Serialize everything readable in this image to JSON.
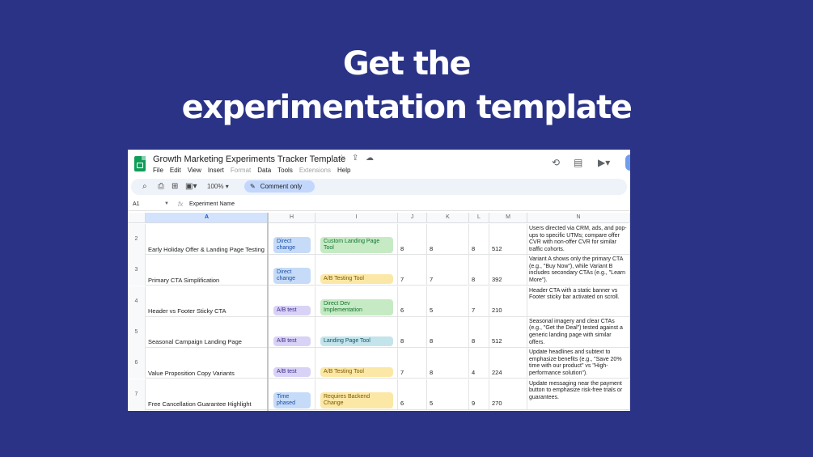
{
  "hero": {
    "line1": "Get the",
    "line2": "experimentation template"
  },
  "window": {
    "title": "Growth Marketing Experiments Tracker Template",
    "icons": [
      "star-icon",
      "move-to-drive-icon",
      "cloud-status-icon",
      "history-icon",
      "comments-icon",
      "meet-icon"
    ],
    "menu": [
      {
        "label": "File",
        "enabled": true
      },
      {
        "label": "Edit",
        "enabled": true
      },
      {
        "label": "View",
        "enabled": true
      },
      {
        "label": "Insert",
        "enabled": true
      },
      {
        "label": "Format",
        "enabled": false
      },
      {
        "label": "Data",
        "enabled": true
      },
      {
        "label": "Tools",
        "enabled": true
      },
      {
        "label": "Extensions",
        "enabled": false
      },
      {
        "label": "Help",
        "enabled": true
      }
    ]
  },
  "toolbar": {
    "zoom": "100%",
    "comment_label": "Comment only"
  },
  "formula": {
    "cell_ref": "A1",
    "fx": "fx",
    "content": "Experiment Name"
  },
  "columns": [
    "A",
    "H",
    "I",
    "J",
    "K",
    "L",
    "M",
    "N"
  ],
  "rows": [
    {
      "num": "2",
      "name": "Early Holiday Offer & Landing Page Testing",
      "h": {
        "text": "Direct change",
        "color": "blue"
      },
      "i": {
        "text": "Custom Landing Page Tool",
        "color": "green"
      },
      "j": "8",
      "k": "8",
      "l": "8",
      "m": "512",
      "n": "Users directed via CRM, ads, and pop-ups to specific UTMs; compare offer CVR with non-offer CVR for similar traffic cohorts."
    },
    {
      "num": "3",
      "name": "Primary CTA Simplification",
      "h": {
        "text": "Direct change",
        "color": "blue"
      },
      "i": {
        "text": "A/B Testing Tool",
        "color": "yellow"
      },
      "j": "7",
      "k": "7",
      "l": "8",
      "m": "392",
      "n": "Variant A shows only the primary CTA (e.g., \"Buy Now\"), while Variant B includes secondary CTAs (e.g., \"Learn More\")."
    },
    {
      "num": "4",
      "name": "Header vs Footer Sticky CTA",
      "h": {
        "text": "A/B test",
        "color": "purple"
      },
      "i": {
        "text": "Direct Dev Implementation",
        "color": "green"
      },
      "j": "6",
      "k": "5",
      "l": "7",
      "m": "210",
      "n": "Header CTA with a static banner vs Footer sticky bar activated on scroll."
    },
    {
      "num": "5",
      "name": "Seasonal Campaign Landing Page",
      "h": {
        "text": "A/B test",
        "color": "purple"
      },
      "i": {
        "text": "Landing Page Tool",
        "color": "teal"
      },
      "j": "8",
      "k": "8",
      "l": "8",
      "m": "512",
      "n": "Seasonal imagery and clear CTAs (e.g., \"Get the Deal\") tested against a generic landing page with similar offers."
    },
    {
      "num": "6",
      "name": "Value Proposition Copy Variants",
      "h": {
        "text": "A/B test",
        "color": "purple"
      },
      "i": {
        "text": "A/B Testing Tool",
        "color": "yellow"
      },
      "j": "7",
      "k": "8",
      "l": "4",
      "m": "224",
      "n": "Update headlines and subtext to emphasize benefits (e.g., \"Save 20% time with our product\" vs \"High-performance solution\")."
    },
    {
      "num": "7",
      "name": "Free Cancellation Guarantee Highlight",
      "h": {
        "text": "Time phased",
        "color": "blue"
      },
      "i": {
        "text": "Requires Backend Change",
        "color": "yellow"
      },
      "j": "6",
      "k": "5",
      "l": "9",
      "m": "270",
      "n": "Update messaging near the payment button to emphasize risk-free trials or guarantees."
    }
  ]
}
